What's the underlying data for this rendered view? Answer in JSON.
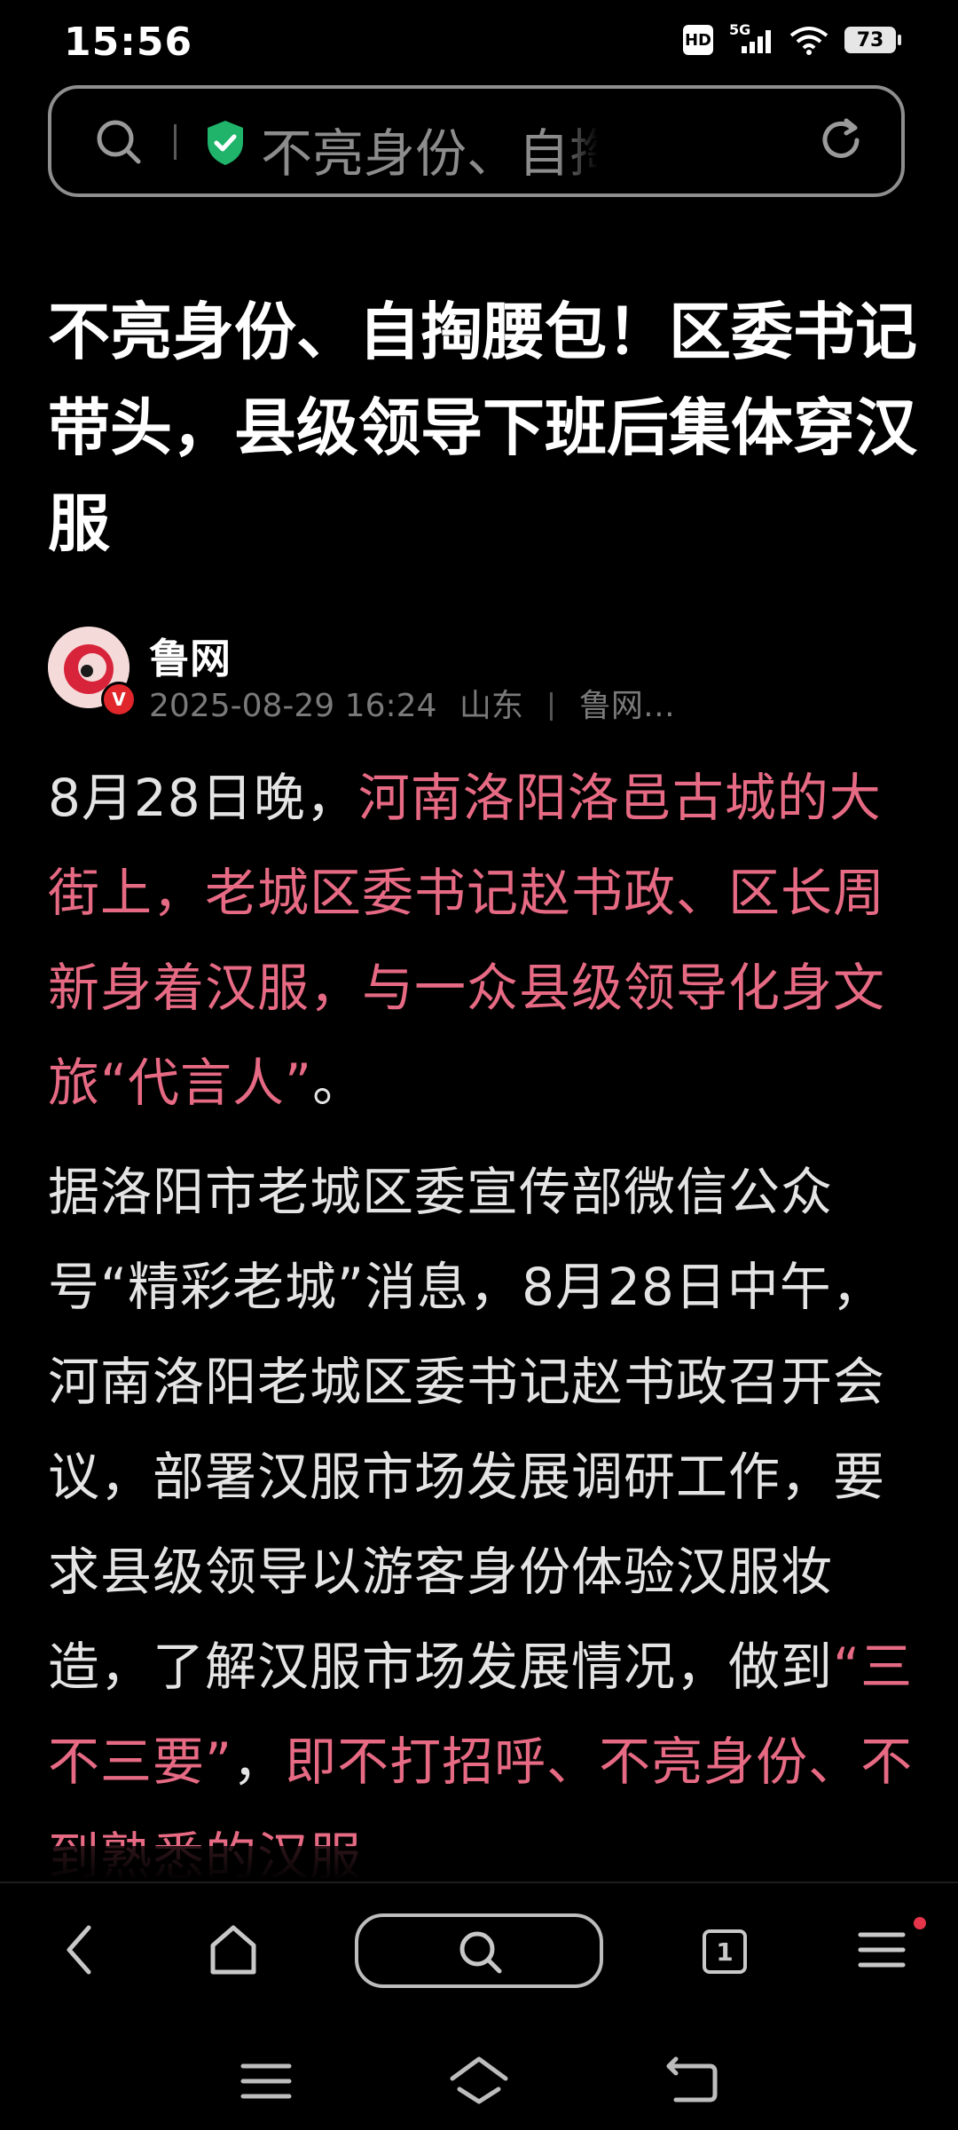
{
  "status_bar": {
    "time": "15:56",
    "hd": "HD",
    "network": "5G",
    "battery": "73"
  },
  "address_bar": {
    "page_title": "不亮身份、自掏腰包！",
    "icons": [
      "search-icon",
      "secure-shield-icon",
      "reload-icon"
    ],
    "secure_color": "#1fb46a"
  },
  "article": {
    "title": "不亮身份、自掏腰包！区委书记带头，县级领导下班后集体穿汉服",
    "author": {
      "name": "鲁网",
      "verified_badge": "V",
      "date": "2025-08-29 16:24",
      "location": "山东",
      "source": "鲁网…"
    },
    "p1_prefix": "8月28日晚，",
    "p1_highlight": "河南洛阳洛邑古城的大街上，老城区委书记赵书政、区长周新身着汉服，与一众县级领导化身文旅“代言人”",
    "p1_suffix": "。",
    "p2_text": "据洛阳市老城区委宣传部微信公众号“精彩老城”消息，8月28日中午，河南洛阳老城区委书记赵书政召开会议，部署汉服市场发展调研工作，要求县级领导以游客身份体验汉服妆造，了解汉服市场发展情况，做到",
    "p2_quote": "“三不三要”",
    "p2_comma": "，",
    "p2_highlight": "即不打招呼、不亮身份、不到熟悉的汉服",
    "highlight_color": "#e66a83"
  },
  "browser_bar": {
    "items": [
      "back-icon",
      "home-icon",
      "search-icon",
      "tabs-icon",
      "menu-icon"
    ],
    "tab_count": "1"
  },
  "system_nav": {
    "items": [
      "recents-icon",
      "home-icon",
      "back-icon"
    ]
  }
}
